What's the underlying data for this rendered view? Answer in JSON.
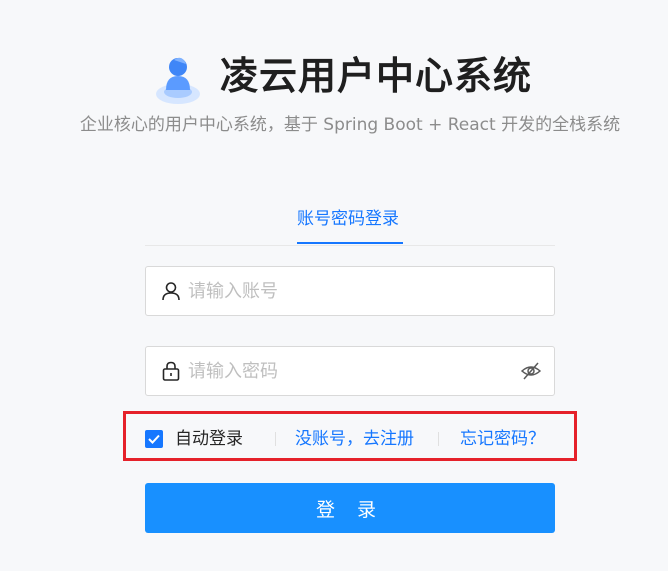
{
  "app": {
    "title": "凌云用户中心系统",
    "subtitle": "企业核心的用户中心系统，基于 Spring Boot + React 开发的全栈系统"
  },
  "tabs": [
    {
      "label": "账号密码登录",
      "active": true
    }
  ],
  "form": {
    "account": {
      "placeholder": "请输入账号",
      "value": ""
    },
    "password": {
      "placeholder": "请输入密码",
      "value": ""
    },
    "auto_login": {
      "label": "自动登录",
      "checked": true
    },
    "register_link": "没账号，去注册",
    "forgot_link": "忘记密码？",
    "submit_label": "登 录"
  },
  "icons": {
    "logo": "user-cloud-logo",
    "account": "user-icon",
    "password": "lock-icon",
    "toggle": "eye-invisible-icon",
    "checkbox": "check-icon"
  },
  "colors": {
    "primary": "#1677ff",
    "button": "#1890ff",
    "highlight_border": "#e5212a"
  }
}
